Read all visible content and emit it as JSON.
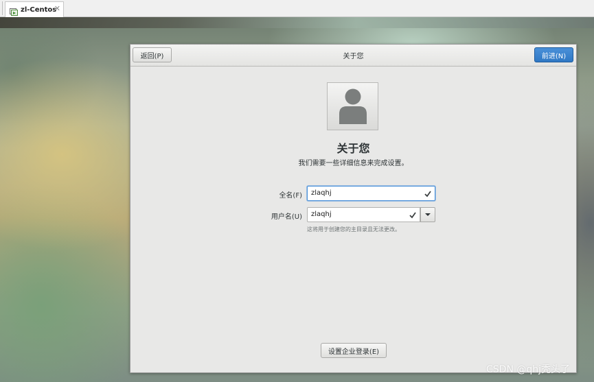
{
  "host": {
    "tab_label": "zl-Centos"
  },
  "dialog": {
    "title": "关于您",
    "back_label": "返回(P)",
    "next_label": "前进(N)",
    "heading": "关于您",
    "subtitle": "我们需要一些详细信息来完成设置。",
    "fullname_label": "全名(F)",
    "fullname_value": "zlaqhj",
    "username_label": "用户名(U)",
    "username_value": "zlaqhj",
    "username_hint": "这将用于创建您的主目录且无法更改。",
    "enterprise_login_label": "设置企业登录(E)"
  },
  "watermark": "CSDN @qhj秃头了",
  "colors": {
    "accent": "#4a90d9",
    "dialog_bg": "#e8e8e7",
    "text": "#2e3436"
  },
  "icons": {
    "avatar": "user-avatar-icon",
    "check": "check-icon",
    "dropdown": "chevron-down-icon",
    "close": "close-icon",
    "vm": "vm-icon"
  }
}
